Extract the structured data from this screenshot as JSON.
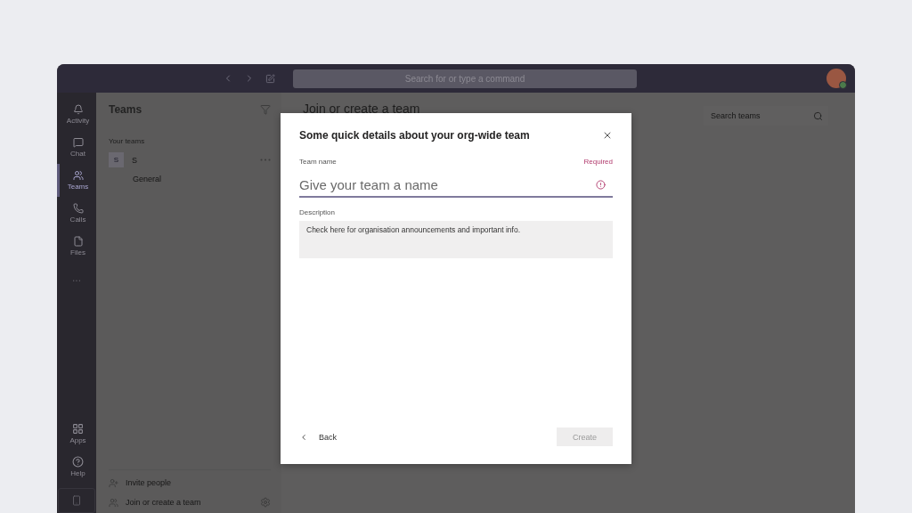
{
  "title_bar": {
    "search_placeholder": "Search for or type a command"
  },
  "rail": {
    "top": [
      {
        "label": "Activity",
        "selected": false
      },
      {
        "label": "Chat",
        "selected": false
      },
      {
        "label": "Teams",
        "selected": true
      },
      {
        "label": "Calls",
        "selected": false
      },
      {
        "label": "Files",
        "selected": false
      }
    ],
    "more": "...",
    "bottom": [
      {
        "label": "Apps"
      },
      {
        "label": "Help"
      }
    ]
  },
  "sidebar": {
    "title": "Teams",
    "section": "Your teams",
    "teams": [
      {
        "avatar": "S",
        "name": "S",
        "channels": [
          "General"
        ]
      }
    ],
    "footer": [
      "Invite people",
      "Join or create a team"
    ]
  },
  "main": {
    "heading": "Join or create a team",
    "search_placeholder": "Search teams"
  },
  "dialog": {
    "title": "Some quick details about your org-wide team",
    "fields": [
      {
        "kind": "input",
        "label": "Team name",
        "note": "Required",
        "placeholder": "Give your team a name"
      },
      {
        "kind": "textarea",
        "label": "Description",
        "value": "Check here for organisation announcements and important info."
      }
    ],
    "back": "Back",
    "create": {
      "label": "Create",
      "disabled": true
    }
  }
}
